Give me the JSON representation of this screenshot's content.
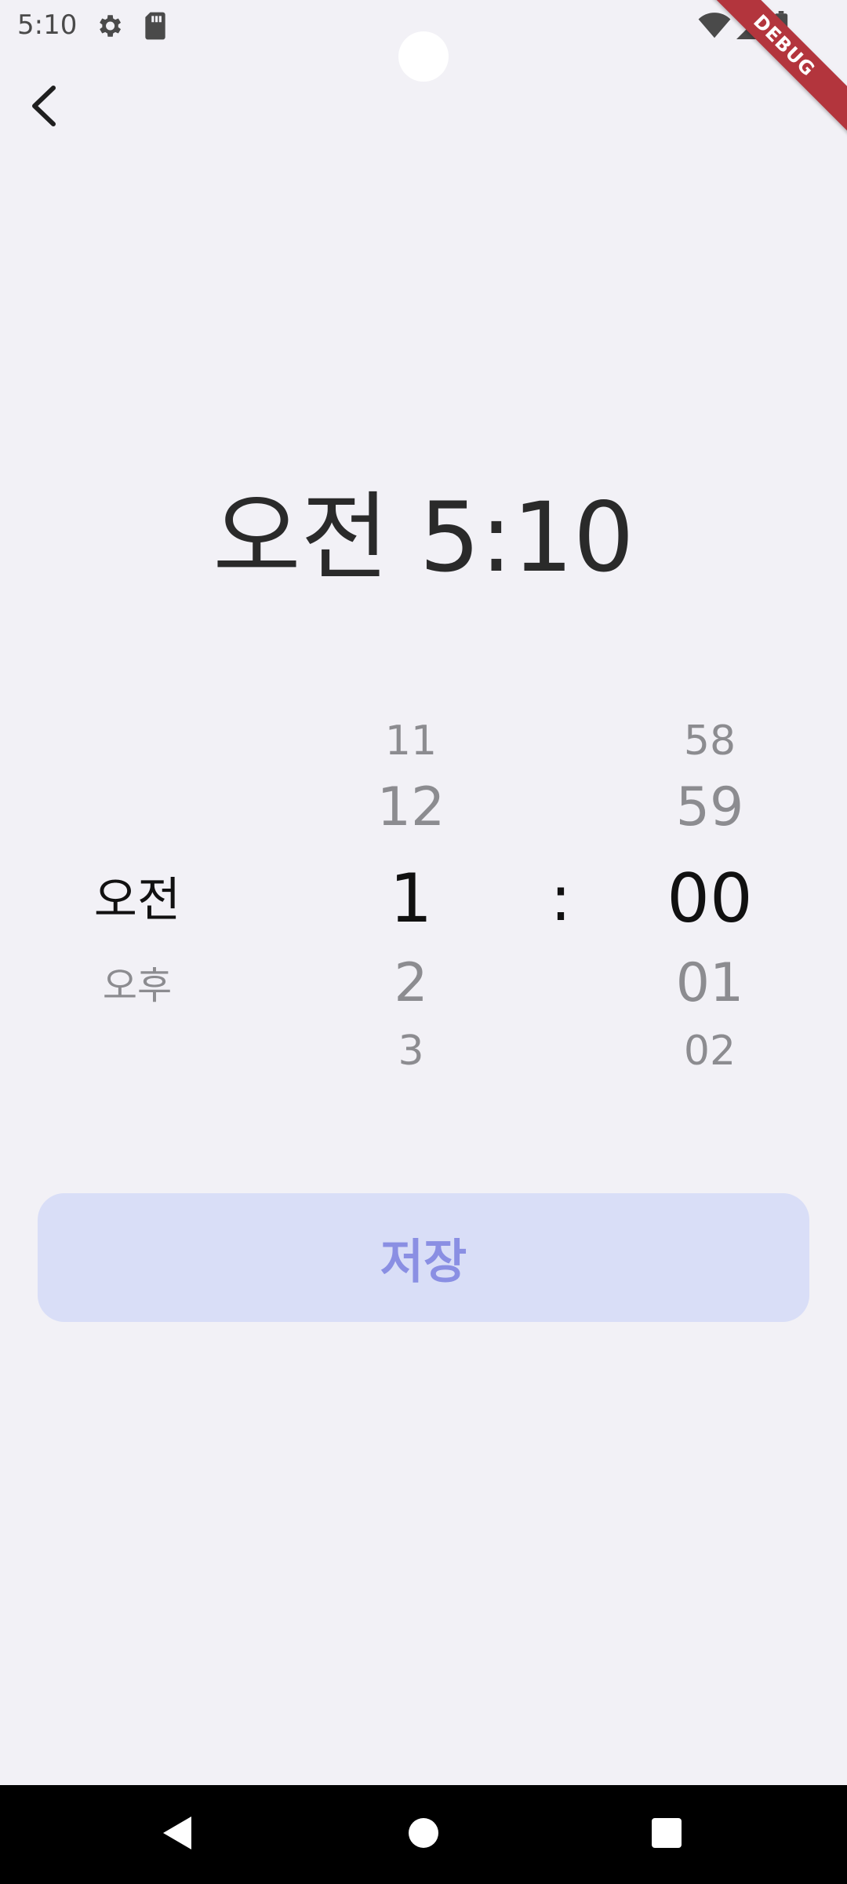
{
  "status_bar": {
    "time": "5:10",
    "icons": [
      "gear-icon",
      "sd-card-icon",
      "wifi-icon",
      "signal-icon",
      "battery-icon"
    ]
  },
  "debug_banner": {
    "label": "DEBUG"
  },
  "header": {
    "back_icon": "chevron-left-icon"
  },
  "display": {
    "time": "오전 5:10"
  },
  "picker": {
    "ampm": {
      "selected": "오전",
      "below": [
        "오후"
      ]
    },
    "hour": {
      "above": [
        "11",
        "12"
      ],
      "selected": "1",
      "below": [
        "2",
        "3"
      ]
    },
    "separator": ":",
    "minute": {
      "above": [
        "58",
        "59"
      ],
      "selected": "00",
      "below": [
        "01",
        "02"
      ]
    }
  },
  "save_button": {
    "label": "저장"
  },
  "nav_bar": {
    "buttons": [
      "back-triangle-icon",
      "home-circle-icon",
      "recents-square-icon"
    ]
  },
  "colors": {
    "background": "#f2f1f6",
    "button_bg": "#d9def7",
    "button_text": "#8a8fe3",
    "debug_banner": "#b3353d"
  }
}
